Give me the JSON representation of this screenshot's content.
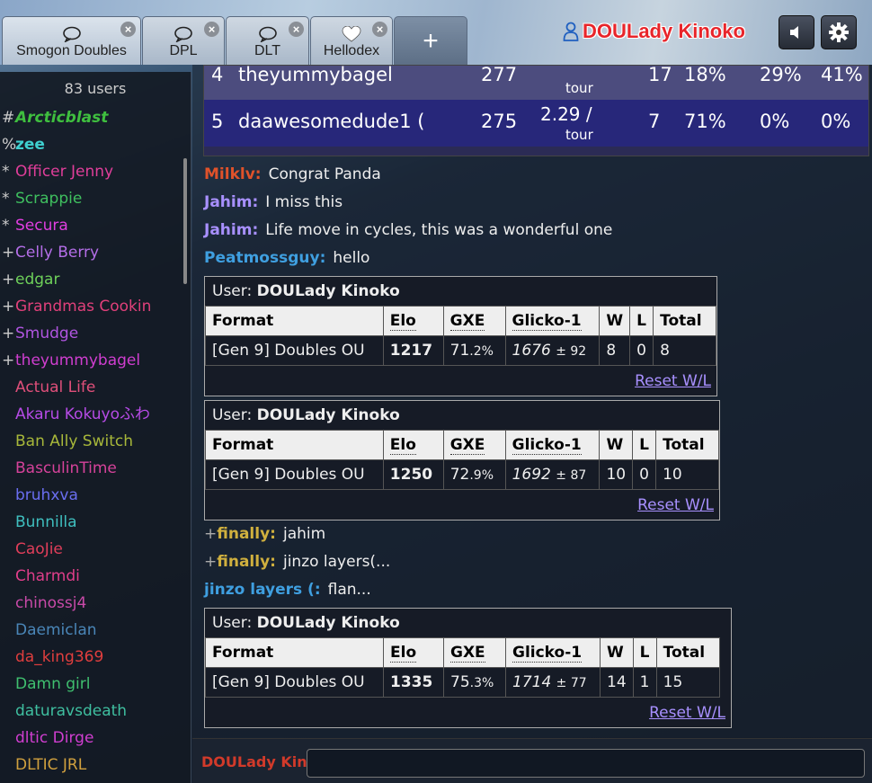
{
  "tabs": [
    {
      "label": "Smogon Doubles",
      "icon": "speech-bubble-icon",
      "active": true
    },
    {
      "label": "DPL",
      "icon": "speech-bubble-icon",
      "active": false
    },
    {
      "label": "DLT",
      "icon": "speech-bubble-icon",
      "active": false
    },
    {
      "label": "Hellodex",
      "icon": "heart-icon",
      "active": false
    }
  ],
  "add_tab_label": "+",
  "current_user": "DOULady Kinoko",
  "userlist": {
    "count_label": "83 users",
    "users": [
      {
        "rank": "#",
        "name": "Arcticblast",
        "color": "#3fbf3f",
        "style": "italic-bold"
      },
      {
        "rank": "%",
        "name": "zee",
        "color": "#3fd0d0",
        "style": "bold"
      },
      {
        "rank": "*",
        "name": "Officer Jenny",
        "color": "#e03e9a",
        "style": ""
      },
      {
        "rank": "*",
        "name": "Scrappie",
        "color": "#3fbf5f",
        "style": ""
      },
      {
        "rank": "*",
        "name": "Secura",
        "color": "#e03ee0",
        "style": ""
      },
      {
        "rank": "+",
        "name": "Celly Berry",
        "color": "#b46ee8",
        "style": ""
      },
      {
        "rank": "+",
        "name": "edgar",
        "color": "#6ed05a",
        "style": ""
      },
      {
        "rank": "+",
        "name": "Grandmas Cookin",
        "color": "#e0407a",
        "style": ""
      },
      {
        "rank": "+",
        "name": "Smudge",
        "color": "#b055e0",
        "style": ""
      },
      {
        "rank": "+",
        "name": "theyummybagel",
        "color": "#d03ed0",
        "style": ""
      },
      {
        "rank": "",
        "name": "Actual Life",
        "color": "#e04f7a",
        "style": ""
      },
      {
        "rank": "",
        "name": "Akaru Kokuyoふわ",
        "color": "#b64be6",
        "style": ""
      },
      {
        "rank": "",
        "name": "Ban Ally Switch",
        "color": "#a8b83a",
        "style": ""
      },
      {
        "rank": "",
        "name": "BasculinTime",
        "color": "#d6429a",
        "style": ""
      },
      {
        "rank": "",
        "name": "bruhxva",
        "color": "#6a6ef0",
        "style": ""
      },
      {
        "rank": "",
        "name": "Bunnilla",
        "color": "#3fbfbf",
        "style": ""
      },
      {
        "rank": "",
        "name": "CaoJie",
        "color": "#e03e5a",
        "style": ""
      },
      {
        "rank": "",
        "name": "Charmdi",
        "color": "#e03e8a",
        "style": ""
      },
      {
        "rank": "",
        "name": "chinossj4",
        "color": "#c84aa8",
        "style": ""
      },
      {
        "rank": "",
        "name": "Daemiclan",
        "color": "#4a86b8",
        "style": ""
      },
      {
        "rank": "",
        "name": "da_king369",
        "color": "#e03e3e",
        "style": ""
      },
      {
        "rank": "",
        "name": "Damn girl",
        "color": "#3fbf6f",
        "style": ""
      },
      {
        "rank": "",
        "name": "daturavsdeath",
        "color": "#3fbfa0",
        "style": ""
      },
      {
        "rank": "",
        "name": "dltic Dirge",
        "color": "#d03ed0",
        "style": ""
      },
      {
        "rank": "",
        "name": "DLTIC JRL",
        "color": "#d0a03e",
        "style": ""
      }
    ]
  },
  "ladder": {
    "rows": [
      {
        "rank": "4",
        "name": "theyummybagel",
        "elo": "277",
        "gxe": "",
        "tour": "tour",
        "w": "17",
        "p1": "18%",
        "p2": "29%",
        "p3": "41%"
      },
      {
        "rank": "5",
        "name": "daawesomedude1 (",
        "elo": "275",
        "gxe": "2.29 /",
        "tour": "tour",
        "w": "7",
        "p1": "71%",
        "p2": "0%",
        "p3": "0%"
      }
    ]
  },
  "messages": [
    {
      "name": "Milklv:",
      "color": "#e0522a",
      "group": "",
      "text": "Congrat Panda"
    },
    {
      "name": "Jahim:",
      "color": "#a890ff",
      "group": "",
      "text": "I miss this"
    },
    {
      "name": "Jahim:",
      "color": "#a890ff",
      "group": "",
      "text": "Life move in cycles, this was a wonderful one"
    },
    {
      "name": "Peatmossguy:",
      "color": "#3f9fe0",
      "group": "",
      "text": "hello"
    },
    {
      "name": "finally:",
      "color": "#d0b03e",
      "group": "+",
      "text": "jahim"
    },
    {
      "name": "finally:",
      "color": "#d0b03e",
      "group": "+",
      "text": "jinzo layers(..."
    },
    {
      "name": "jinzo layers (:",
      "color": "#3f9fe0",
      "group": "",
      "text": "flan..."
    }
  ],
  "rank_cards": [
    {
      "title_prefix": "User:",
      "user": "DOULady Kinoko",
      "headers": [
        "Format",
        "Elo",
        "GXE",
        "Glicko-1",
        "W",
        "L",
        "Total"
      ],
      "format": "[Gen 9] Doubles OU",
      "elo": "1217",
      "gxe_int": "71",
      "gxe_dec": ".2%",
      "glicko": "1676",
      "glicko_dev": "± 92",
      "w": "8",
      "l": "0",
      "total": "8",
      "reset": "Reset W/L"
    },
    {
      "title_prefix": "User:",
      "user": "DOULady Kinoko",
      "headers": [
        "Format",
        "Elo",
        "GXE",
        "Glicko-1",
        "W",
        "L",
        "Total"
      ],
      "format": "[Gen 9] Doubles OU",
      "elo": "1250",
      "gxe_int": "72",
      "gxe_dec": ".9%",
      "glicko": "1692",
      "glicko_dev": "± 87",
      "w": "10",
      "l": "0",
      "total": "10",
      "reset": "Reset W/L"
    },
    {
      "title_prefix": "User:",
      "user": "DOULady Kinoko",
      "headers": [
        "Format",
        "Elo",
        "GXE",
        "Glicko-1",
        "W",
        "L",
        "Total"
      ],
      "format": "[Gen 9] Doubles OU",
      "elo": "1335",
      "gxe_int": "75",
      "gxe_dec": ".3%",
      "glicko": "1714",
      "glicko_dev": "± 77",
      "w": "14",
      "l": "1",
      "total": "15",
      "reset": "Reset W/L"
    }
  ],
  "composer": {
    "name": "DOULady Kinoko",
    "placeholder": ""
  }
}
